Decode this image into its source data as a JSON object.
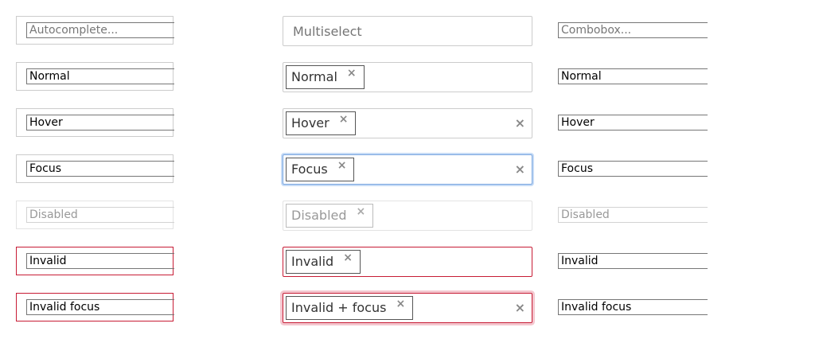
{
  "autocomplete": [
    {
      "text": "Autocomplete...",
      "state": "placeholder"
    },
    {
      "text": "Normal",
      "state": "normal"
    },
    {
      "text": "Hover",
      "state": "hover"
    },
    {
      "text": "Focus",
      "state": "focus"
    },
    {
      "text": "Disabled",
      "state": "disabled"
    },
    {
      "text": "Invalid",
      "state": "invalid"
    },
    {
      "text": "Invalid focus",
      "state": "invalid-focus"
    }
  ],
  "multiselect": [
    {
      "placeholder": "Multiselect",
      "tag": null,
      "clear": false,
      "state": "placeholder"
    },
    {
      "tag": "Normal",
      "remove_icon": "×",
      "clear": false,
      "state": "normal"
    },
    {
      "tag": "Hover",
      "remove_icon": "×",
      "clear": true,
      "clear_icon": "×",
      "state": "hover"
    },
    {
      "tag": "Focus",
      "remove_icon": "×",
      "clear": true,
      "clear_icon": "×",
      "state": "focus"
    },
    {
      "tag": "Disabled",
      "remove_icon": "×",
      "clear": false,
      "state": "disabled"
    },
    {
      "tag": "Invalid",
      "remove_icon": "×",
      "clear": false,
      "state": "invalid"
    },
    {
      "tag": "Invalid + focus",
      "remove_icon": "×",
      "clear": true,
      "clear_icon": "×",
      "state": "invalid-focus"
    }
  ],
  "combobox": [
    {
      "text": "Combobox...",
      "state": "placeholder"
    },
    {
      "text": "Normal",
      "state": "normal"
    },
    {
      "text": "Hover",
      "state": "hover"
    },
    {
      "text": "Focus",
      "state": "focus"
    },
    {
      "text": "Disabled",
      "state": "disabled"
    },
    {
      "text": "Invalid",
      "state": "invalid"
    },
    {
      "text": "Invalid focus",
      "state": "invalid-focus"
    }
  ],
  "colors": {
    "border": "#cccccc",
    "invalid": "#c71c35",
    "focus_ring": "#c6dbf6",
    "invalid_focus_ring": "#f4c7cf"
  }
}
